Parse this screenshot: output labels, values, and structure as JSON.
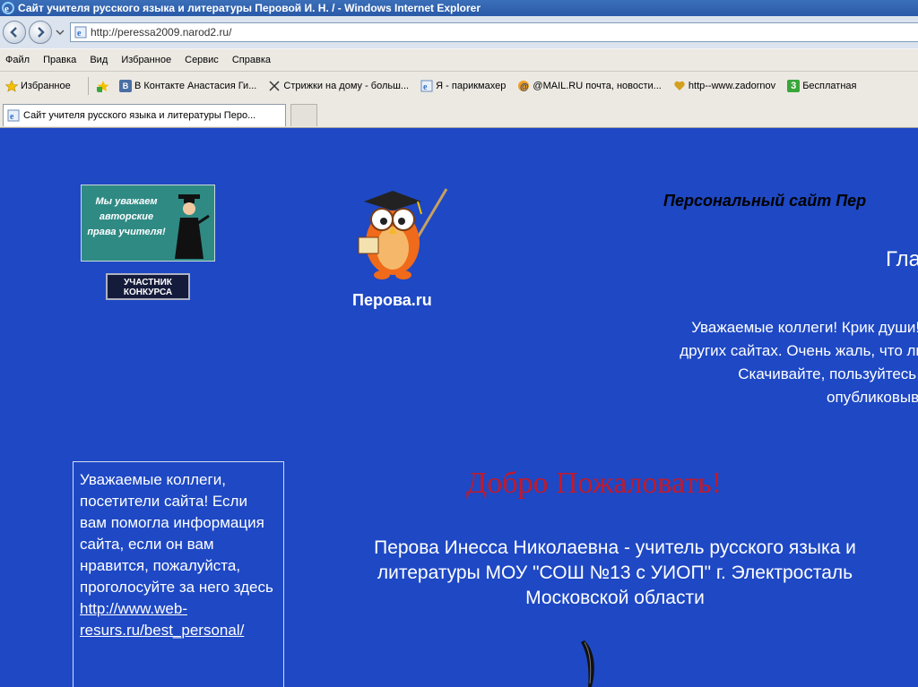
{
  "window": {
    "title": "Сайт учителя русского языка и литературы Перовой И. Н. / - Windows Internet Explorer"
  },
  "address": {
    "url": "http://peressa2009.narod2.ru/"
  },
  "menu": [
    "Файл",
    "Правка",
    "Вид",
    "Избранное",
    "Сервис",
    "Справка"
  ],
  "favorites": {
    "label": "Избранное",
    "items": [
      {
        "label": "В Контакте  Анастасия Ги...",
        "icon": "vk-icon",
        "color": "#4a6fa5"
      },
      {
        "label": "Стрижки на дому - больш...",
        "icon": "scissors-icon",
        "color": "#333333"
      },
      {
        "label": "Я - парикмахер",
        "icon": "ie-page-icon",
        "color": "#2b6cc4"
      },
      {
        "label": "@MAIL.RU почта, новости...",
        "icon": "mail-ru-icon",
        "color": "#f0a020"
      },
      {
        "label": "http--www.zadornov",
        "icon": "heart-icon",
        "color": "#c8a020"
      },
      {
        "label": "Бесплатная",
        "icon": "green-3-icon",
        "color": "#3aa63a"
      }
    ]
  },
  "tab": {
    "label": "Сайт учителя русского языка и литературы Перо..."
  },
  "page": {
    "banner_text": "Мы уважаем авторские права учителя!",
    "badge_line1": "УЧАСТНИК",
    "badge_line2": "КОНКУРСА",
    "owl_caption": "Перова.ru",
    "site_title": "Персональный сайт Пер",
    "section_heading": "Гла",
    "intro_lines": [
      "Уважаемые коллеги! Крик души! Пост",
      "других сайтах. Очень жаль, что люди і",
      "Скачивайте, пользуйтесь в рабо",
      "опубликовыват"
    ],
    "welcome": "Добро Пожаловать!",
    "teacher_info": "Перова Инесса Николаевна - учитель русского языка и литературы МОУ \"СОШ №13 с УИОП\" г. Электросталь Московской области",
    "vote_text": "Уважаемые коллеги, посетители сайта! Если вам помогла информация сайта, если он вам нравится, пожалуйста, проголосуйте за него здесь ",
    "vote_link": "http://www.web-resurs.ru/best_personal/"
  }
}
